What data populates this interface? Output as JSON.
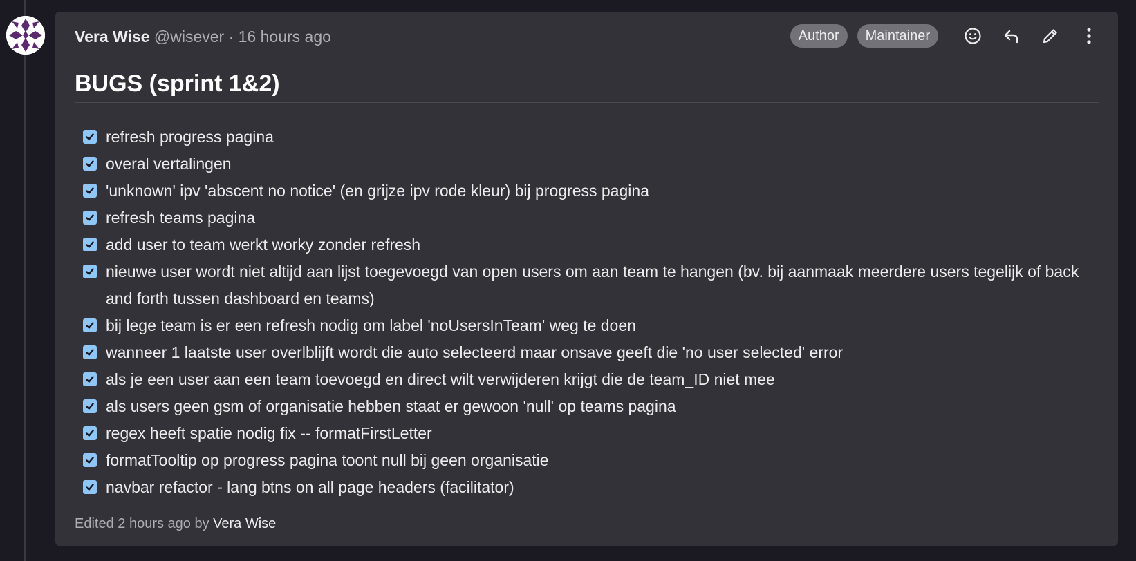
{
  "note": {
    "author_name": "Vera Wise",
    "author_handle": "@wisever",
    "separator": "·",
    "timestamp": "16 hours ago",
    "badges": [
      "Author",
      "Maintainer"
    ],
    "actions": [
      {
        "name": "add-reaction",
        "icon": "smiley-icon"
      },
      {
        "name": "reply",
        "icon": "reply-arrow-icon"
      },
      {
        "name": "edit",
        "icon": "pencil-icon"
      },
      {
        "name": "more-actions",
        "icon": "vertical-ellipsis-icon"
      }
    ],
    "title": "BUGS (sprint 1&2)",
    "tasks": [
      {
        "checked": true,
        "text": "refresh progress pagina"
      },
      {
        "checked": true,
        "text": "overal vertalingen"
      },
      {
        "checked": true,
        "text": "'unknown' ipv 'abscent no notice' (en grijze ipv rode kleur) bij progress pagina"
      },
      {
        "checked": true,
        "text": "refresh teams pagina"
      },
      {
        "checked": true,
        "text": "add user to team werkt worky zonder refresh"
      },
      {
        "checked": true,
        "text": "nieuwe user wordt niet altijd aan lijst toegevoegd van open users om aan team te hangen (bv. bij aanmaak meerdere users tegelijk of back and forth tussen dashboard en teams)"
      },
      {
        "checked": true,
        "text": "bij lege team is er een refresh nodig om label 'noUsersInTeam' weg te doen"
      },
      {
        "checked": true,
        "text": "wanneer 1 laatste user overlblijft wordt die auto selecteerd maar onsave geeft die 'no user selected' error"
      },
      {
        "checked": true,
        "text": "als je een user aan een team toevoegd en direct wilt verwijderen krijgt die de team_ID niet mee"
      },
      {
        "checked": true,
        "text": "als users geen gsm of organisatie hebben staat er gewoon 'null' op teams pagina"
      },
      {
        "checked": true,
        "text": "regex heeft spatie nodig fix -- formatFirstLetter"
      },
      {
        "checked": true,
        "text": "formatTooltip op progress pagina toont null bij geen organisatie"
      },
      {
        "checked": true,
        "text": "navbar refactor - lang btns on all page headers (facilitator)"
      }
    ],
    "edited_prefix": "Edited 2 hours ago by",
    "edited_by": "Vera Wise"
  },
  "colors": {
    "page_background": "#1b1a22",
    "note_background": "#333238",
    "badge_background": "#737278",
    "checkbox": "#8fc6f8",
    "avatar_pattern": "#5b2a6e"
  }
}
